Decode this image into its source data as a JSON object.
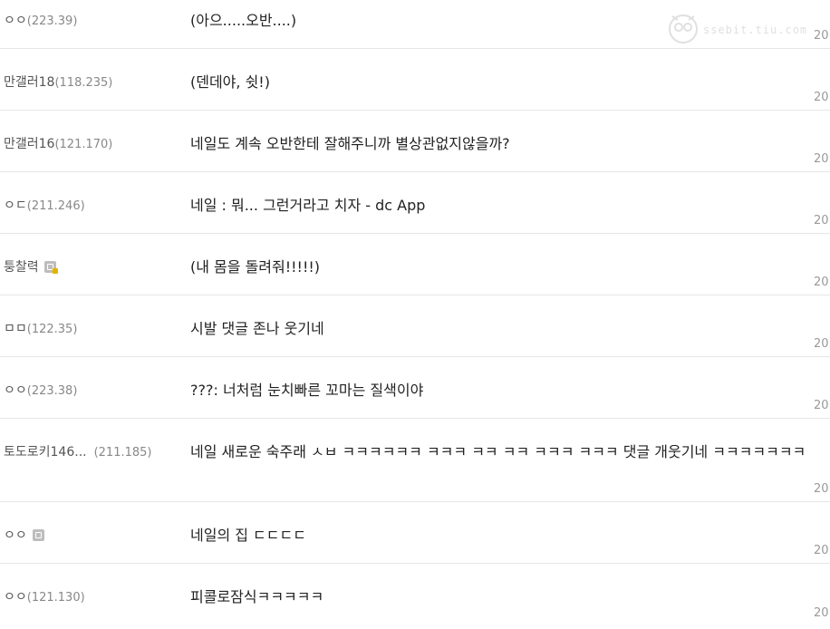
{
  "comments": [
    {
      "author": "ㅇㅇ",
      "ip": "(223.39)",
      "text": "(아으.....오반....)",
      "date": "20"
    },
    {
      "author": "만갤러18",
      "ip": "(118.235)",
      "text": "(덴데야, 쉿!)",
      "date": "20"
    },
    {
      "author": "만갤러16",
      "ip": "(121.170)",
      "text": "네일도 계속 오반한테 잘해주니까 별상관없지않을까?",
      "date": "20"
    },
    {
      "author": "ㅇㄷ",
      "ip": "(211.246)",
      "text": "네일 : 뭐... 그런거라고 치자 - dc App",
      "date": "20"
    },
    {
      "author": "퉁찰력",
      "ip": "",
      "badge": "lock-badge",
      "text": "(내 몸을 돌려줘!!!!!)",
      "date": "20"
    },
    {
      "author": "ㅁㅁ",
      "ip": "(122.35)",
      "text": "시발 댓글 존나 웃기네",
      "date": "20"
    },
    {
      "author": "ㅇㅇ",
      "ip": "(223.38)",
      "text": "???: 너처럼 눈치빠른 꼬마는 질색이야",
      "date": "20"
    },
    {
      "author": "토도로키146...",
      "ip": "(211.185)",
      "text": "네일 새로운 숙주래 ㅅㅂ ㅋㅋㅋㅋㅋㅋ ㅋㅋㅋ ㅋㅋ ㅋㅋ ㅋㅋㅋ ㅋㅋㅋ 댓글 개웃기네 ㅋㅋㅋㅋㅋㅋㅋ",
      "date": "20"
    },
    {
      "author": "ㅇㅇ",
      "ip": "",
      "badge": "member-badge",
      "text": "네일의 집 ㄷㄷㄷㄷ",
      "date": "20"
    },
    {
      "author": "ㅇㅇ",
      "ip": "(121.130)",
      "text": "피콜로잠식ㅋㅋㅋㅋㅋ",
      "date": "20"
    }
  ],
  "watermark": {
    "text": "ssebit.tiu.com",
    "icon": "owl-logo-icon"
  }
}
